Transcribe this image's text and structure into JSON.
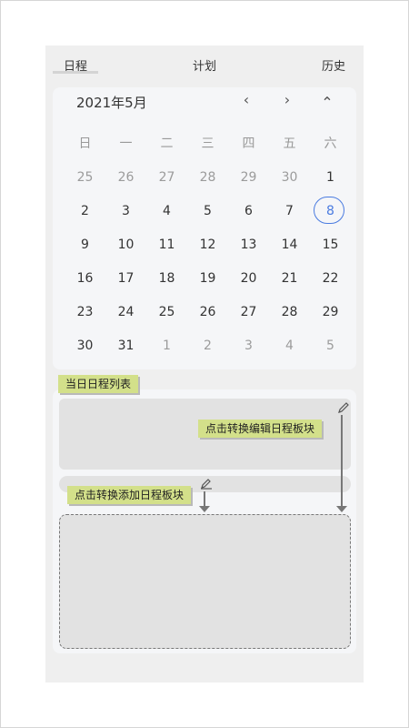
{
  "tabs": [
    {
      "label": "日程",
      "active": true
    },
    {
      "label": "计划",
      "active": false
    },
    {
      "label": "历史",
      "active": false
    }
  ],
  "calendar": {
    "title": "2021年5月",
    "nav": {
      "prev": "‹",
      "next": "›",
      "collapse": "⌃"
    },
    "weekdays": [
      "日",
      "一",
      "二",
      "三",
      "四",
      "五",
      "六"
    ],
    "weeks": [
      [
        {
          "d": "25",
          "in": false
        },
        {
          "d": "26",
          "in": false
        },
        {
          "d": "27",
          "in": false
        },
        {
          "d": "28",
          "in": false
        },
        {
          "d": "29",
          "in": false
        },
        {
          "d": "30",
          "in": false
        },
        {
          "d": "1",
          "in": true
        }
      ],
      [
        {
          "d": "2",
          "in": true
        },
        {
          "d": "3",
          "in": true
        },
        {
          "d": "4",
          "in": true
        },
        {
          "d": "5",
          "in": true
        },
        {
          "d": "6",
          "in": true
        },
        {
          "d": "7",
          "in": true
        },
        {
          "d": "8",
          "in": true,
          "today": true
        }
      ],
      [
        {
          "d": "9",
          "in": true
        },
        {
          "d": "10",
          "in": true
        },
        {
          "d": "11",
          "in": true
        },
        {
          "d": "12",
          "in": true
        },
        {
          "d": "13",
          "in": true
        },
        {
          "d": "14",
          "in": true
        },
        {
          "d": "15",
          "in": true
        }
      ],
      [
        {
          "d": "16",
          "in": true
        },
        {
          "d": "17",
          "in": true
        },
        {
          "d": "18",
          "in": true
        },
        {
          "d": "19",
          "in": true
        },
        {
          "d": "20",
          "in": true
        },
        {
          "d": "21",
          "in": true
        },
        {
          "d": "22",
          "in": true
        }
      ],
      [
        {
          "d": "23",
          "in": true
        },
        {
          "d": "24",
          "in": true
        },
        {
          "d": "25",
          "in": true
        },
        {
          "d": "26",
          "in": true
        },
        {
          "d": "27",
          "in": true
        },
        {
          "d": "28",
          "in": true
        },
        {
          "d": "29",
          "in": true
        }
      ],
      [
        {
          "d": "30",
          "in": true
        },
        {
          "d": "31",
          "in": true
        },
        {
          "d": "1",
          "in": false
        },
        {
          "d": "2",
          "in": false
        },
        {
          "d": "3",
          "in": false
        },
        {
          "d": "4",
          "in": false
        },
        {
          "d": "5",
          "in": false
        }
      ]
    ]
  },
  "annotations": {
    "daily_list": "当日日程列表",
    "edit_toggle": "点击转换编辑日程板块",
    "add_toggle": "点击转换添加日程板块"
  },
  "icons": {
    "edit": "pencil-icon",
    "add": "add-edit-icon"
  },
  "colors": {
    "accent": "#4a7be0",
    "note": "#d3e08a"
  }
}
